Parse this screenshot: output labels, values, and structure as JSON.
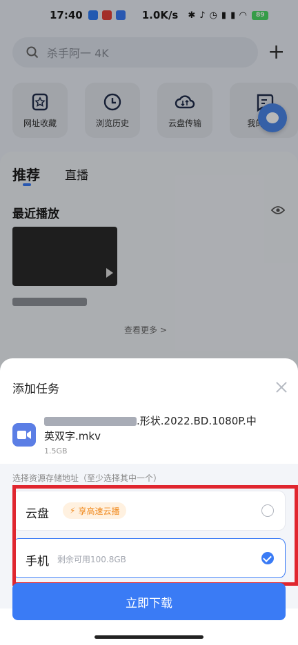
{
  "status_bar": {
    "time": "17:40",
    "speed": "1.0K/s",
    "battery": "89"
  },
  "search": {
    "placeholder": "杀手阿一 4K"
  },
  "shortcuts": [
    {
      "label": "网址收藏",
      "icon": "bookmark-icon"
    },
    {
      "label": "浏览历史",
      "icon": "clock-icon"
    },
    {
      "label": "云盘传输",
      "icon": "cloud-transfer-icon"
    },
    {
      "label": "我的消息",
      "icon": "message-icon"
    }
  ],
  "tabs": {
    "recommend": "推荐",
    "live": "直播"
  },
  "recent": {
    "title": "最近播放",
    "see_more": "查看更多 >"
  },
  "sheet": {
    "title": "添加任务",
    "file_name_visible": ".形状.2022.BD.1080P.中英双字.mkv",
    "file_size": "1.5GB",
    "storage_hint": "选择资源存储地址（至少选择其中一个）",
    "cloud_label": "云盘",
    "cloud_badge": "享高速云播",
    "phone_label": "手机",
    "phone_free": "剩余可用100.8GB",
    "download_button": "立即下载"
  },
  "colors": {
    "accent": "#3a7bf5",
    "highlight": "#e0262f",
    "badge_text": "#f08a1f"
  }
}
